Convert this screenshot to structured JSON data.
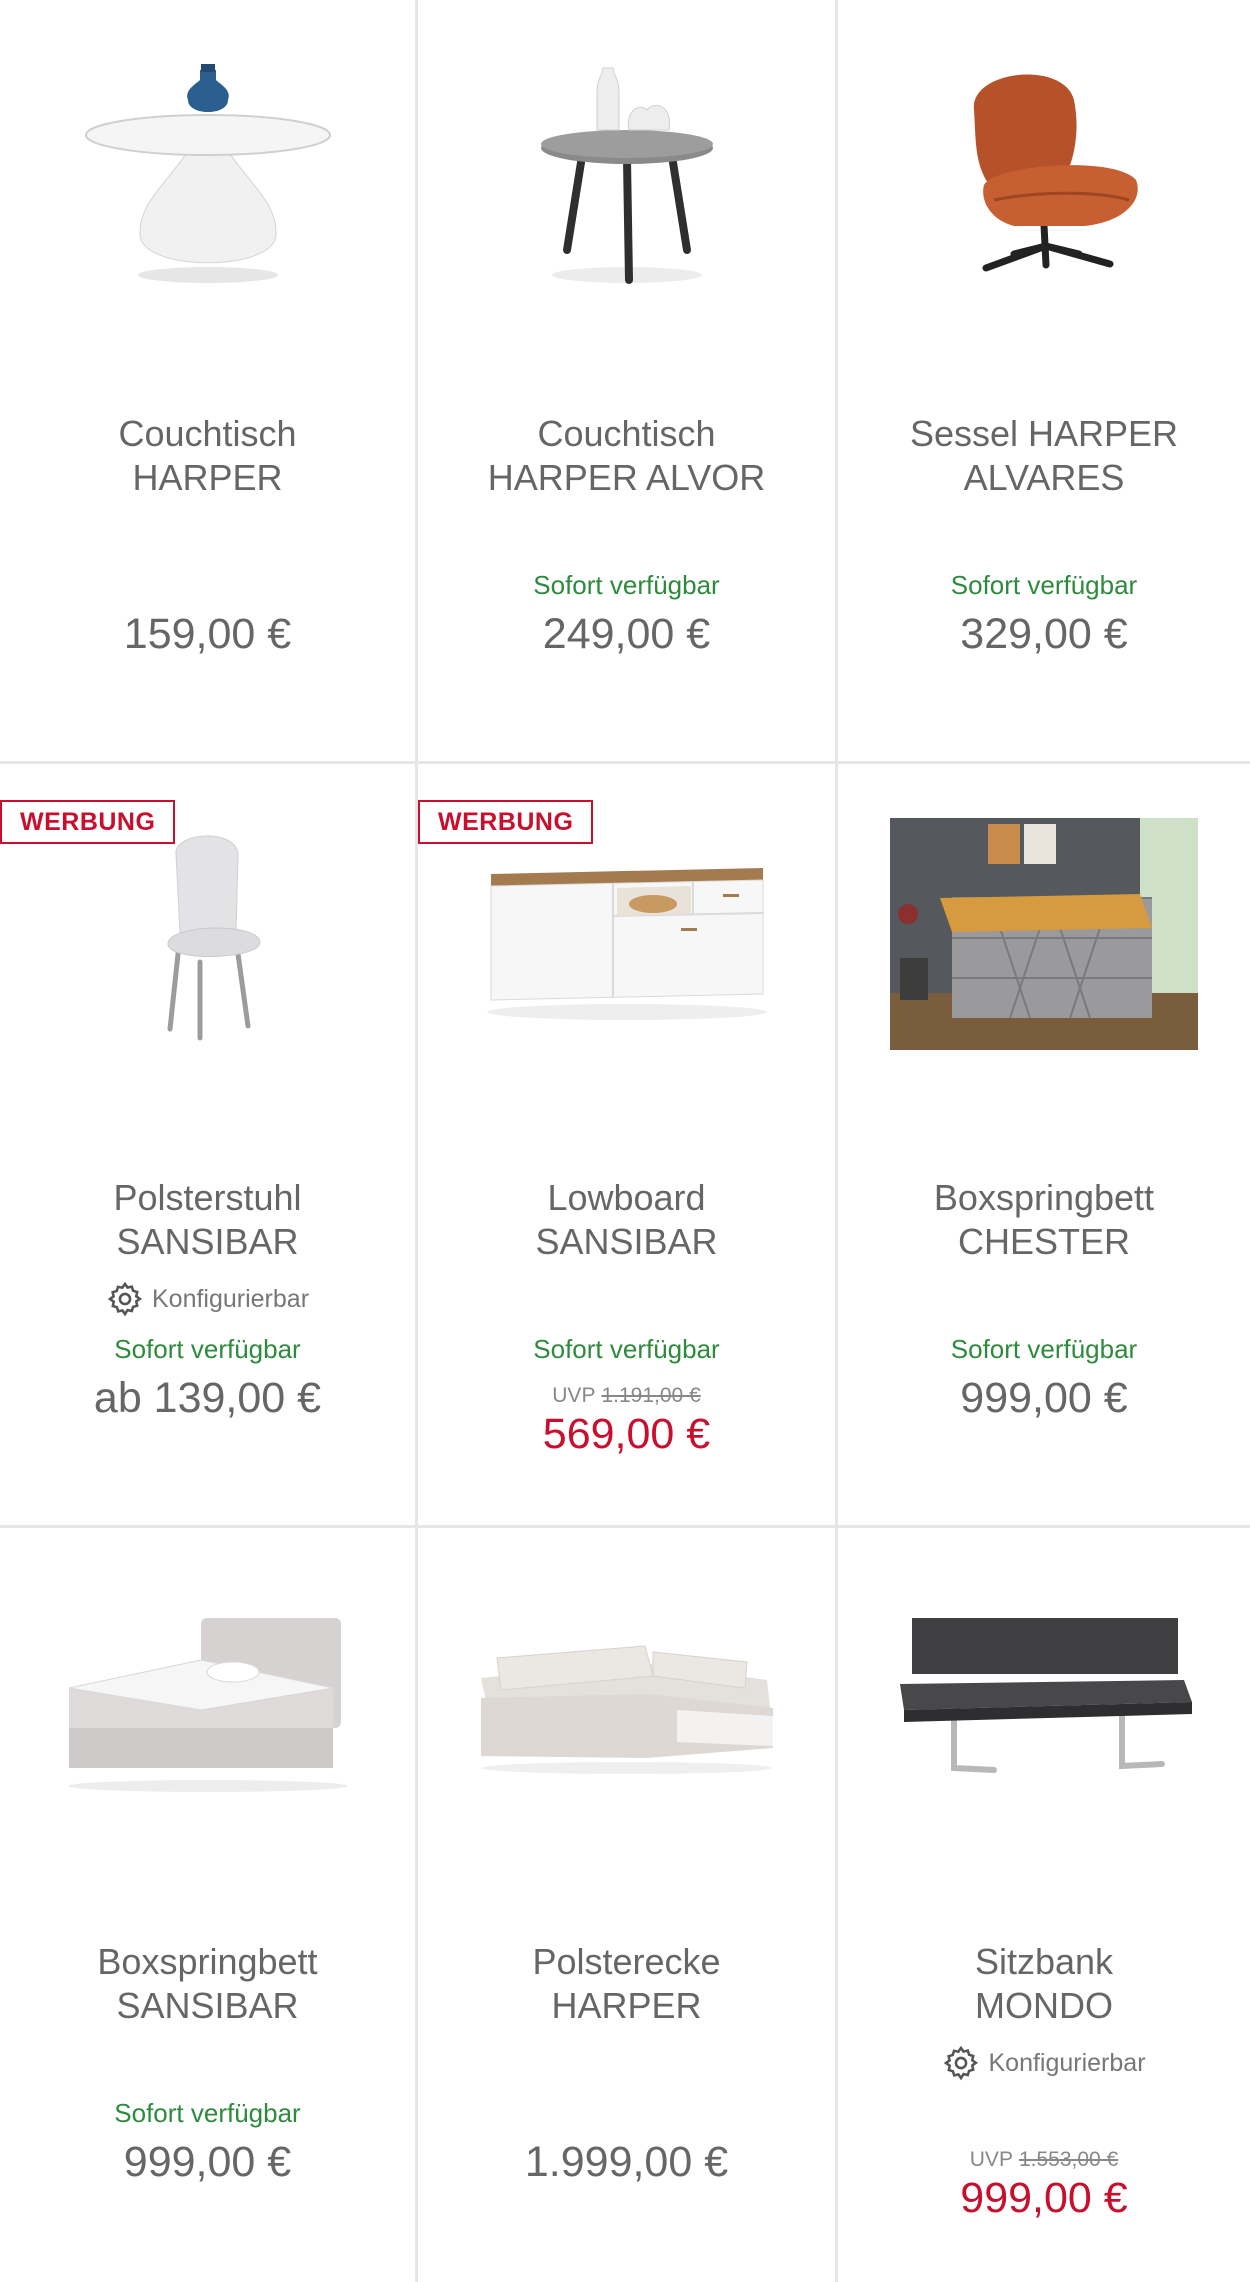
{
  "colors": {
    "available": "#2e8b3d",
    "sale": "#c8102e",
    "badge": "#c8102e",
    "text": "#666666",
    "divider": "#e6e6e6"
  },
  "products": [
    {
      "image_icon": "round-coffee-table-icon",
      "title": [
        "Couchtisch",
        "HARPER"
      ],
      "price": "159,00 €"
    },
    {
      "image_icon": "side-table-icon",
      "title": [
        "Couchtisch",
        "HARPER ALVOR"
      ],
      "availability": "Sofort verfügbar",
      "price": "249,00 €"
    },
    {
      "image_icon": "armchair-icon",
      "title": [
        "Sessel HARPER",
        "ALVARES"
      ],
      "availability": "Sofort verfügbar",
      "price": "329,00 €"
    },
    {
      "badge": "WERBUNG",
      "image_icon": "dining-chair-icon",
      "title": [
        "Polsterstuhl",
        "SANSIBAR"
      ],
      "config_label": "Konfigurierbar",
      "availability": "Sofort verfügbar",
      "price": "ab 139,00 €"
    },
    {
      "badge": "WERBUNG",
      "image_icon": "lowboard-icon",
      "title": [
        "Lowboard",
        "SANSIBAR"
      ],
      "availability": "Sofort verfügbar",
      "uvp_label": "UVP",
      "uvp_price": "1.191,00 €",
      "sale_price": "569,00 €"
    },
    {
      "image_icon": "bedroom-photo-icon",
      "title": [
        "Boxspringbett",
        "CHESTER"
      ],
      "availability": "Sofort verfügbar",
      "price": "999,00 €"
    },
    {
      "image_icon": "boxspring-bed-icon",
      "title": [
        "Boxspringbett",
        "SANSIBAR"
      ],
      "availability": "Sofort verfügbar",
      "price": "999,00 €"
    },
    {
      "image_icon": "corner-sofa-icon",
      "title": [
        "Polsterecke",
        "HARPER"
      ],
      "price": "1.999,00 €"
    },
    {
      "image_icon": "bench-icon",
      "title": [
        "Sitzbank",
        "MONDO"
      ],
      "config_label": "Konfigurierbar",
      "uvp_label": "UVP",
      "uvp_price": "1.553,00 €",
      "sale_price": "999,00 €"
    }
  ]
}
